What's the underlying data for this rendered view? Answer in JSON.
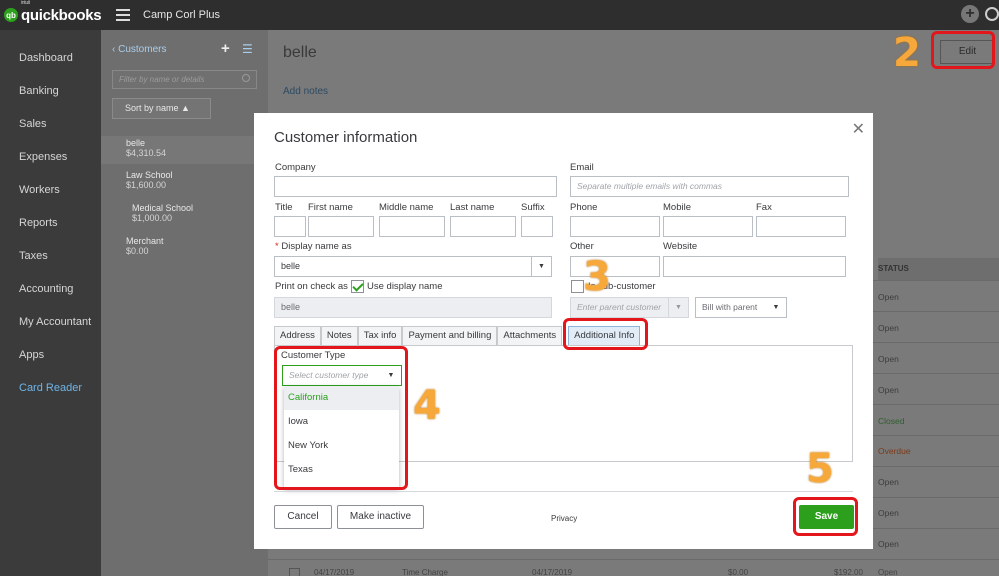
{
  "topbar": {
    "logo_small": "intuit",
    "logo_text": "quickbooks",
    "logo_badge": "qb",
    "company": "Camp Corl Plus"
  },
  "leftnav": {
    "items": [
      "Dashboard",
      "Banking",
      "Sales",
      "Expenses",
      "Workers",
      "Reports",
      "Taxes",
      "Accounting",
      "My Accountant",
      "Apps",
      "Card Reader"
    ]
  },
  "customers": {
    "back_label": "Customers",
    "filter_placeholder": "Filter by name or details",
    "sort_label": "Sort by name ▲",
    "list": [
      {
        "name": "belle",
        "amount": "$4,310.54"
      },
      {
        "name": "Law School",
        "amount": "$1,600.00"
      },
      {
        "name": "Medical School",
        "amount": "$1,000.00"
      },
      {
        "name": "Merchant",
        "amount": "$0.00"
      }
    ]
  },
  "main": {
    "title": "belle",
    "add_notes": "Add notes",
    "edit_label": "Edit",
    "status_header": "STATUS",
    "statuses": [
      "Open",
      "Open",
      "Open",
      "Open",
      "Closed",
      "Overdue",
      "Open",
      "Open",
      "Open",
      "Open"
    ],
    "bottom_row": {
      "date1": "04/17/2019",
      "type": "Time Charge",
      "date2": "04/17/2019",
      "amount1": "$0.00",
      "amount2": "$192.00",
      "status": "Open"
    }
  },
  "modal": {
    "title": "Customer information",
    "close": "✕",
    "labels": {
      "company": "Company",
      "email": "Email",
      "title": "Title",
      "first_name": "First name",
      "middle_name": "Middle name",
      "last_name": "Last name",
      "suffix": "Suffix",
      "phone": "Phone",
      "mobile": "Mobile",
      "fax": "Fax",
      "required_mark": "*",
      "display_name": "Display name as",
      "other": "Other",
      "website": "Website",
      "print_on_check": "Print on check as",
      "use_display_name": "Use display name",
      "is_sub_customer": "Is sub-customer",
      "customer_type": "Customer Type",
      "privacy": "Privacy"
    },
    "values": {
      "display_name": "belle",
      "print_on_check": "belle"
    },
    "placeholders": {
      "email": "Separate multiple emails with commas",
      "parent_customer": "Enter parent customer",
      "bill_with_parent": "Bill with parent",
      "customer_type": "Select customer type"
    },
    "tabs": [
      "Address",
      "Notes",
      "Tax info",
      "Payment and billing",
      "Attachments",
      "Additional Info"
    ],
    "customer_type_options": [
      "California",
      "Iowa",
      "New York",
      "Texas"
    ],
    "buttons": {
      "cancel": "Cancel",
      "make_inactive": "Make inactive",
      "save": "Save"
    }
  },
  "annotations": {
    "steps": [
      "2",
      "3",
      "4",
      "5"
    ],
    "color": "#e3161b",
    "number_color": "#f7a83a"
  }
}
